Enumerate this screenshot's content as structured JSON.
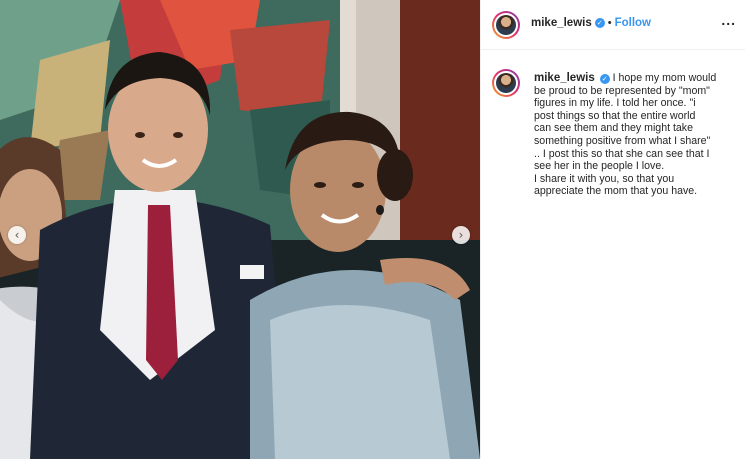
{
  "post": {
    "username": "mike_lewis",
    "follow_label": "Follow",
    "separator": "•",
    "more_icon": "...",
    "caption_lines": [
      "I hope my mom would",
      "be proud to be represented by \"mom\"",
      "figures in my life. I told her once. \"i",
      "post things so that the entire world",
      "can see them and they might take",
      "something positive from what I share\"",
      ".. I post this so that she can see that I",
      "see her in the people I love.",
      "I share it with you, so that you",
      "appreciate the mom that you have."
    ]
  },
  "nav": {
    "prev_glyph": "‹",
    "next_glyph": "›"
  },
  "icons": {
    "verified": "verified-badge-icon",
    "more": "more-options-icon"
  },
  "colors": {
    "accent": "#3897f0",
    "text": "#262626",
    "border": "#efefef"
  }
}
